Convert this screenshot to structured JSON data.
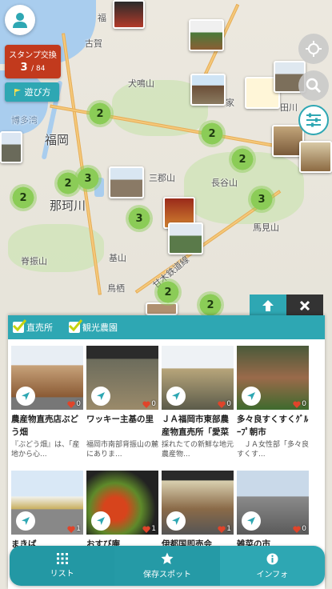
{
  "map": {
    "labels": [
      {
        "text": "福岡",
        "cls": "big"
      },
      {
        "text": "博多湾",
        "cls": "blue"
      },
      {
        "text": "那珂川",
        "cls": "big"
      },
      {
        "text": "古賀",
        "cls": ""
      },
      {
        "text": "犬鳴山",
        "cls": ""
      },
      {
        "text": "三郡山",
        "cls": ""
      },
      {
        "text": "長谷山",
        "cls": ""
      },
      {
        "text": "馬見山",
        "cls": ""
      },
      {
        "text": "脊振山",
        "cls": ""
      },
      {
        "text": "基山",
        "cls": ""
      },
      {
        "text": "甘木鉄道線",
        "cls": ""
      },
      {
        "text": "鳥栖",
        "cls": ""
      },
      {
        "text": "田川",
        "cls": ""
      },
      {
        "text": "福",
        "cls": ""
      },
      {
        "text": "家",
        "cls": ""
      }
    ],
    "clusters": [
      "2",
      "2",
      "2",
      "3",
      "2",
      "2",
      "3",
      "3",
      "2",
      "2"
    ]
  },
  "stamp": {
    "title": "スタンプ交換",
    "count": "3",
    "total": "/ 84"
  },
  "howto": {
    "label": "遊び方"
  },
  "filters": [
    {
      "label": "直売所",
      "checked": true
    },
    {
      "label": "観光農園",
      "checked": true
    }
  ],
  "spots": [
    {
      "name": "農産物直売店ぶどう畑",
      "desc": "『ぶどう畑』は、「産地から心...",
      "likes": "0"
    },
    {
      "name": "ワッキー主基の里",
      "desc": "福岡市南部背振山の麓にありま...",
      "likes": "0"
    },
    {
      "name": "ＪＡ福岡市東部農産物直売所「愛菜市場」",
      "desc": "採れたての新鮮な地元農産物...",
      "likes": "0"
    },
    {
      "name": "多々良すくすくｸﾞﾙｰﾌﾟ朝市",
      "desc": "　ＪＡ女性部「多々良すくす...",
      "likes": "0"
    },
    {
      "name": "まきば",
      "desc": "",
      "likes": "1"
    },
    {
      "name": "おすび庵",
      "desc": "",
      "likes": "1"
    },
    {
      "name": "伊都国即売会",
      "desc": "",
      "likes": "1"
    },
    {
      "name": "雑菜の市",
      "desc": "",
      "likes": "0"
    }
  ],
  "nav": [
    {
      "label": "リスト"
    },
    {
      "label": "保存スポット"
    },
    {
      "label": "インフォ"
    }
  ],
  "colors": {
    "accent": "#2ea7b3",
    "stamp": "#c23a1d",
    "cluster": "#8bcc57"
  }
}
